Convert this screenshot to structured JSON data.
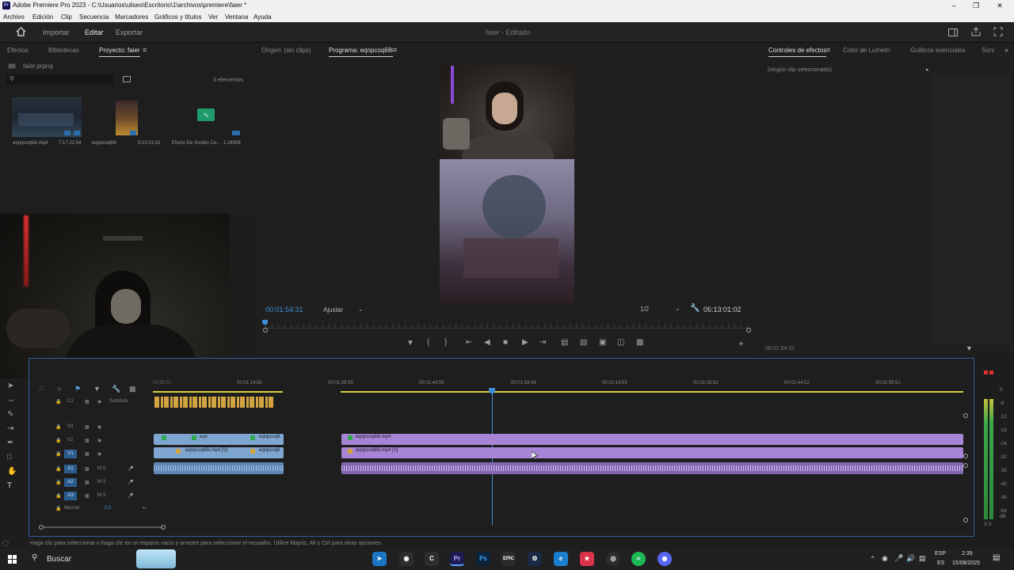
{
  "window": {
    "title": "Adobe Premiere Pro 2023 - C:\\Usuarios\\ulises\\Escritorio\\1\\archivos\\premiere\\faier *",
    "app_icon_label": "Pr"
  },
  "menu": [
    "Archivo",
    "Edición",
    "Clip",
    "Secuencia",
    "Marcadores",
    "Gráficos y títulos",
    "Ver",
    "Ventana",
    "Ayuda"
  ],
  "workspace": {
    "tabs": [
      "Importar",
      "Editar",
      "Exportar"
    ],
    "active_tab": "Editar",
    "project_name": "faier",
    "project_state": "- Editado"
  },
  "project_panel": {
    "tabs": [
      "Efectos",
      "Bibliotecas",
      "Proyecto: faier"
    ],
    "active_tab": "Proyecto: faier",
    "file": "faier.prproj",
    "search_placeholder": "",
    "count": "3 elementos",
    "items": [
      {
        "name": "eqnpcoq68i.mp4",
        "duration": "7:17:21:54"
      },
      {
        "name": "eqnpcoq68i",
        "duration": "5:13:01:02"
      },
      {
        "name": "Efecto De Sonido Ce...",
        "duration": "1:24508"
      }
    ]
  },
  "source_monitor": {
    "tabs": [
      "Origen: (sin clips)",
      "Programa: eqnpcoq68i"
    ],
    "active_tab": "Programa: eqnpcoq68i"
  },
  "program_monitor": {
    "timecode": "00:01:54:31",
    "fit": "Ajustar",
    "resolution": "1/2",
    "duration": "05:13:01:02"
  },
  "effects_panel": {
    "tabs": [
      "Controles de efectos",
      "Color de Lumetri",
      "Gráficos esenciales",
      "Soni"
    ],
    "active_tab": "Controles de efectos",
    "no_clip": "(ningún clip seleccionado)",
    "timecode": "00:01:54:31"
  },
  "timeline": {
    "ruler": [
      "00:59:57",
      "00:01:14:56",
      "00:01:29:55",
      "00:01:44:55",
      "00:01:59:54",
      "00:02:14:53",
      "00:02:29:52",
      "00:02:44:52",
      "00:02:59:51"
    ],
    "tracks": [
      {
        "id": "C1",
        "label": "Subtítulo"
      },
      {
        "id": "V3",
        "label": ""
      },
      {
        "id": "V2",
        "label": ""
      },
      {
        "id": "V1",
        "label": ""
      },
      {
        "id": "A1",
        "label": "M S"
      },
      {
        "id": "A2",
        "label": "M S"
      },
      {
        "id": "A3",
        "label": "M S"
      }
    ],
    "mix_label": "Mezcla",
    "mix_value": "0,0",
    "clips": {
      "v2_a1": "eqn",
      "v2_a2": "eqnpcoq6",
      "v2_b": "eqnpcoq68i.mp4",
      "v1_a": "eqnpcoq68i.mp4 [V]",
      "v1_a2": "eqnpcoq6",
      "v1_b": "eqnpcoq68i.mp4 [V]"
    }
  },
  "meter": {
    "scale": [
      "0",
      "-6",
      "-12",
      "-18",
      "-24",
      "-30",
      "-36",
      "-42",
      "-48",
      "-54",
      "dB"
    ],
    "channels": "S S"
  },
  "status_bar": "Haga clic para seleccionar o haga clic en un espacio vacío y arrastre para seleccionar el recuadro. Utilice Mayús, Alt y Ctrl para otras opciones.",
  "taskbar": {
    "search": "Buscar",
    "lang": "ESP",
    "lang2": "ES",
    "time": "2:39",
    "date": "15/08/2025"
  },
  "colors": {
    "accent_blue": "#3f8fd8",
    "clip_blue": "#7fa6d1",
    "clip_purple": "#a884d6",
    "subtitle_yellow": "#d2a341"
  }
}
